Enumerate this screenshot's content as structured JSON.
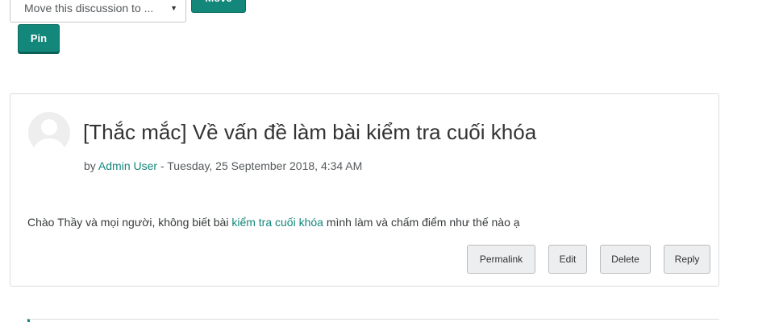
{
  "controls": {
    "move_select_value": "Move this discussion to ...",
    "move_button_label": "Move",
    "pin_button_label": "Pin"
  },
  "post": {
    "title": "[Thắc mắc] Về vấn đề làm bài kiểm tra cuối khóa",
    "byline": {
      "prefix": "by",
      "author": "Admin User",
      "separator": "-",
      "date": "Tuesday, 25 September 2018, 4:34 AM"
    },
    "message": {
      "before_link": "Chào Thầy và mọi người, không biết bài",
      "link_text": "kiểm tra cuối khóa",
      "after_link": "mình làm và chấm điểm như thế nào ạ"
    },
    "actions": {
      "permalink": "Permalink",
      "edit": "Edit",
      "delete": "Delete",
      "reply": "Reply"
    }
  },
  "colors": {
    "brand": "#12877a",
    "button_bg": "#eceeef"
  }
}
